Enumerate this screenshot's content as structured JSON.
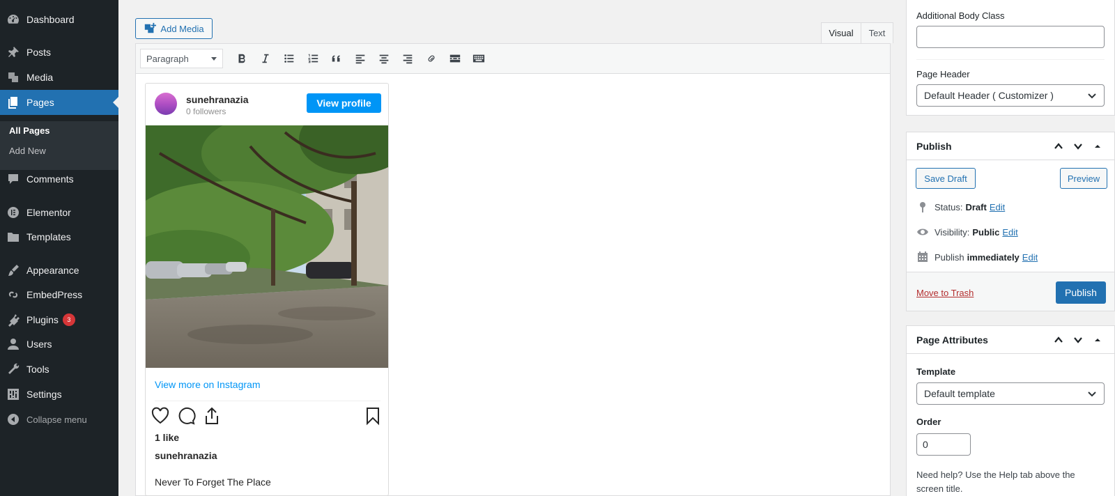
{
  "sidebar": {
    "items": [
      {
        "label": "Dashboard",
        "icon": "dashboard-icon"
      },
      {
        "label": "Posts",
        "icon": "pin-icon"
      },
      {
        "label": "Media",
        "icon": "media-icon"
      },
      {
        "label": "Pages",
        "icon": "pages-icon"
      },
      {
        "label": "Comments",
        "icon": "comment-icon"
      },
      {
        "label": "Elementor",
        "icon": "elementor-icon"
      },
      {
        "label": "Templates",
        "icon": "folder-icon"
      },
      {
        "label": "Appearance",
        "icon": "brush-icon"
      },
      {
        "label": "EmbedPress",
        "icon": "embedpress-icon"
      },
      {
        "label": "Plugins",
        "icon": "plugin-icon"
      },
      {
        "label": "Users",
        "icon": "user-icon"
      },
      {
        "label": "Tools",
        "icon": "wrench-icon"
      },
      {
        "label": "Settings",
        "icon": "settings-icon"
      }
    ],
    "plugins_badge": "3",
    "submenu": {
      "all_pages": "All Pages",
      "add_new": "Add New"
    },
    "collapse_label": "Collapse menu"
  },
  "editor": {
    "add_media": "Add Media",
    "tabs": {
      "visual": "Visual",
      "text": "Text"
    },
    "format_select": "Paragraph"
  },
  "instagram": {
    "username": "sunehranazia",
    "followers": "0 followers",
    "view_profile": "View profile",
    "view_more": "View more on Instagram",
    "likes": "1 like",
    "caption_user": "sunehranazia",
    "caption": "Never To Forget The Place"
  },
  "page_options": {
    "body_class_label": "Additional Body Class",
    "body_class_value": "",
    "page_header_label": "Page Header",
    "page_header_value": "Default Header ( Customizer )"
  },
  "publish": {
    "title": "Publish",
    "save_draft": "Save Draft",
    "preview": "Preview",
    "status_label": "Status:",
    "status_value": "Draft",
    "visibility_label": "Visibility:",
    "visibility_value": "Public",
    "publish_label": "Publish",
    "publish_value": "immediately",
    "edit_link": "Edit",
    "move_to_trash": "Move to Trash",
    "publish_button": "Publish"
  },
  "page_attributes": {
    "title": "Page Attributes",
    "template_label": "Template",
    "template_value": "Default template",
    "order_label": "Order",
    "order_value": "0",
    "help_text": "Need help? Use the Help tab above the screen title."
  },
  "colors": {
    "sidebar_bg": "#1d2327",
    "accent": "#2271b1",
    "instagram_blue": "#0095f6",
    "badge": "#d63638"
  }
}
